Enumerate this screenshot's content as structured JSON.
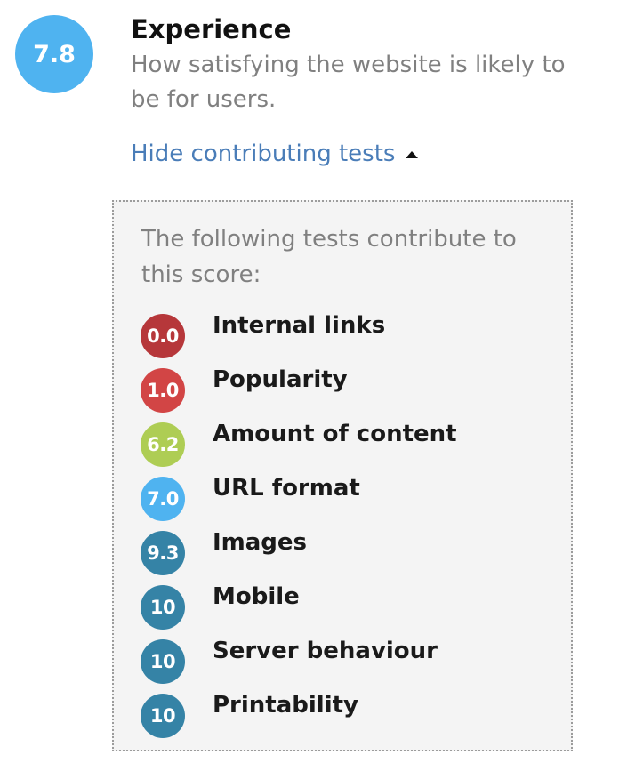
{
  "section": {
    "score": "7.8",
    "score_color": "#4fb3f0",
    "title": "Experience",
    "description": "How satisfying the website is likely to be for users.",
    "toggle_label": "Hide contributing tests",
    "toggle_icon": "caret-up-icon"
  },
  "panel": {
    "intro": "The following tests contribute to this score:",
    "tests": [
      {
        "score": "0.0",
        "name": "Internal links",
        "color": "#b6373a"
      },
      {
        "score": "1.0",
        "name": "Popularity",
        "color": "#d24545"
      },
      {
        "score": "6.2",
        "name": "Amount of content",
        "color": "#aecd54"
      },
      {
        "score": "7.0",
        "name": "URL format",
        "color": "#4fb3f0"
      },
      {
        "score": "9.3",
        "name": "Images",
        "color": "#3583a6"
      },
      {
        "score": "10",
        "name": "Mobile",
        "color": "#3583a6"
      },
      {
        "score": "10",
        "name": "Server behaviour",
        "color": "#3583a6"
      },
      {
        "score": "10",
        "name": "Printability",
        "color": "#3583a6"
      }
    ]
  }
}
